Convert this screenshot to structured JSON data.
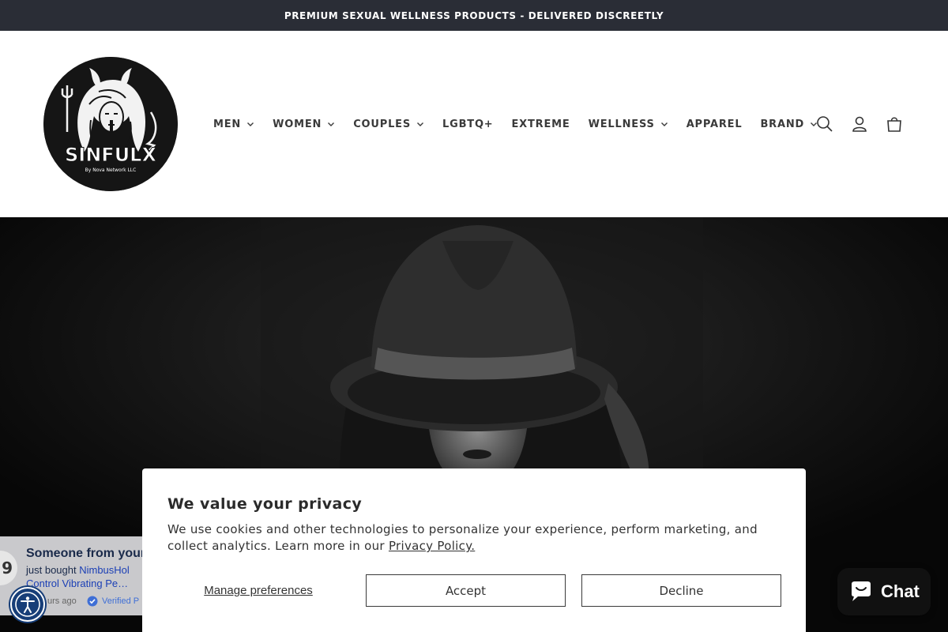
{
  "announcement": "PREMIUM SEXUAL WELLNESS PRODUCTS - DELIVERED DISCREETLY",
  "logo": {
    "name": "SINFULX",
    "tagline": "By Nova Network LLC"
  },
  "nav": [
    {
      "label": "MEN",
      "dropdown": true
    },
    {
      "label": "WOMEN",
      "dropdown": true
    },
    {
      "label": "COUPLES",
      "dropdown": true
    },
    {
      "label": "LGBTQ+",
      "dropdown": false
    },
    {
      "label": "EXTREME",
      "dropdown": false
    },
    {
      "label": "WELLNESS",
      "dropdown": true
    },
    {
      "label": "APPAREL",
      "dropdown": false
    },
    {
      "label": "BRAND",
      "dropdown": true
    }
  ],
  "header_icons": [
    "search-icon",
    "account-icon",
    "cart-icon"
  ],
  "sales_popup": {
    "avatar_text": "9",
    "title": "Someone from your",
    "bought_prefix": "just bought ",
    "product_line1": "NimbusHol",
    "product_line2": "Control Vibrating Pe…",
    "time": "urs ago",
    "verified": "Verified P"
  },
  "cookie": {
    "title": "We value your privacy",
    "text": "We use cookies and other technologies to personalize your experience, perform marketing, and collect analytics. Learn more in our ",
    "link": "Privacy Policy.",
    "manage": "Manage preferences",
    "accept": "Accept",
    "decline": "Decline"
  },
  "chat": {
    "label": "Chat"
  },
  "colors": {
    "announcement_bg": "#2a2d36",
    "hero_bg": "#0b0b0b",
    "accessibility": "#173e78",
    "chat_bg": "#111111",
    "popup_link": "#1b3fb5"
  }
}
